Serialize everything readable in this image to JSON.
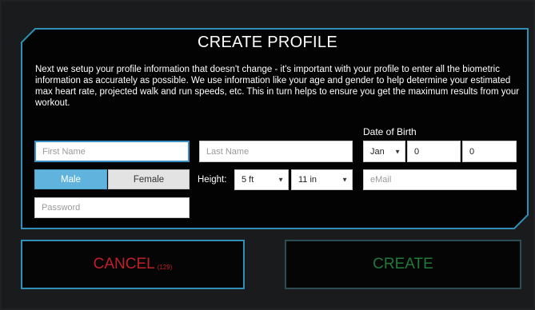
{
  "dialog": {
    "title": "CREATE PROFILE",
    "intro": "Next we setup your profile information that doesn't change - it's important with your profile to enter all the biometric information as accurately as possible. We use information like your age and gender to help determine your estimated max heart rate, projected walk and run speeds, etc. This in turn helps to ensure you get the maximum results from your workout."
  },
  "form": {
    "first_name_placeholder": "First Name",
    "last_name_placeholder": "Last Name",
    "dob_label": "Date of Birth",
    "dob_month": "Jan",
    "dob_day": "0",
    "dob_year": "0",
    "gender_male": "Male",
    "gender_female": "Female",
    "height_label": "Height:",
    "height_feet": "5 ft",
    "height_inches": "11 in",
    "email_placeholder": "eMail",
    "password_placeholder": "Password"
  },
  "buttons": {
    "cancel_label": "CANCEL",
    "cancel_count": "(129)",
    "create_label": "CREATE"
  },
  "colors": {
    "panel_border": "#2f8fb6",
    "male_active": "#5fb3dc",
    "cancel_text": "#c0202a",
    "create_text": "#1e7a3a"
  },
  "icons": {
    "caret": "dropdown-caret-icon"
  }
}
